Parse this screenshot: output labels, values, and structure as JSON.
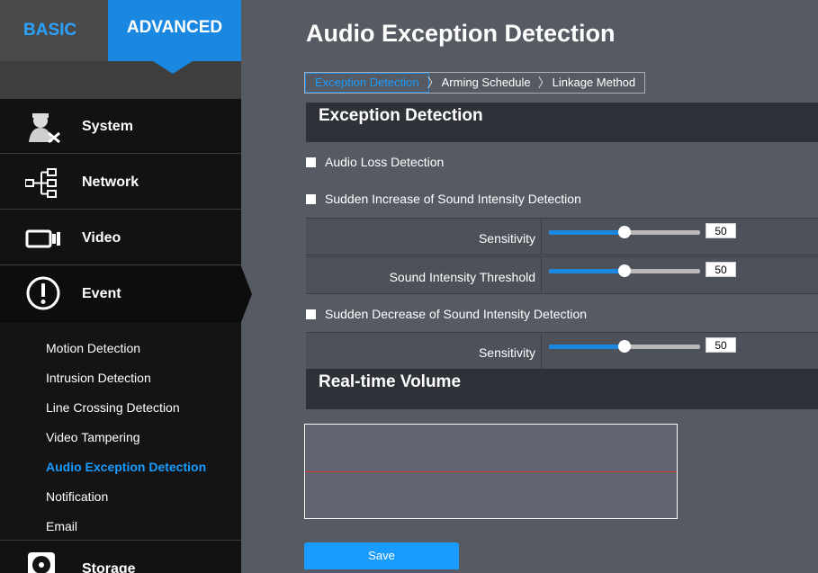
{
  "sidebar": {
    "mode_tabs": {
      "basic": "BASIC",
      "advanced": "ADVANCED"
    },
    "nav": [
      {
        "label": "System",
        "icon": "system-tools-icon"
      },
      {
        "label": "Network",
        "icon": "network-icon"
      },
      {
        "label": "Video",
        "icon": "video-camera-icon"
      },
      {
        "label": "Event",
        "icon": "alert-icon"
      },
      {
        "label": "Storage",
        "icon": "storage-disk-icon"
      }
    ],
    "event_submenu": [
      {
        "label": "Motion Detection"
      },
      {
        "label": "Intrusion Detection"
      },
      {
        "label": "Line Crossing Detection"
      },
      {
        "label": "Video Tampering"
      },
      {
        "label": "Audio Exception Detection",
        "active": true
      },
      {
        "label": "Notification"
      },
      {
        "label": "Email"
      }
    ]
  },
  "main": {
    "title": "Audio Exception Detection",
    "breadcrumb": [
      "Exception Detection",
      "Arming Schedule",
      "Linkage Method"
    ],
    "exception_section": {
      "title": "Exception Detection",
      "audio_loss": {
        "label": "Audio Loss Detection",
        "checked": false
      },
      "sudden_increase": {
        "label": "Sudden Increase of Sound Intensity Detection",
        "checked": false,
        "sensitivity": {
          "label": "Sensitivity",
          "value": "50"
        },
        "threshold": {
          "label": "Sound Intensity Threshold",
          "value": "50"
        }
      },
      "sudden_decrease": {
        "label": "Sudden Decrease of Sound Intensity Detection",
        "checked": false,
        "sensitivity": {
          "label": "Sensitivity",
          "value": "50"
        }
      }
    },
    "volume_section": {
      "title": "Real-time Volume"
    },
    "save_label": "Save"
  },
  "colors": {
    "accent": "#1a88e0",
    "active_text": "#1a9bff",
    "volume_line": "#e0372f"
  }
}
